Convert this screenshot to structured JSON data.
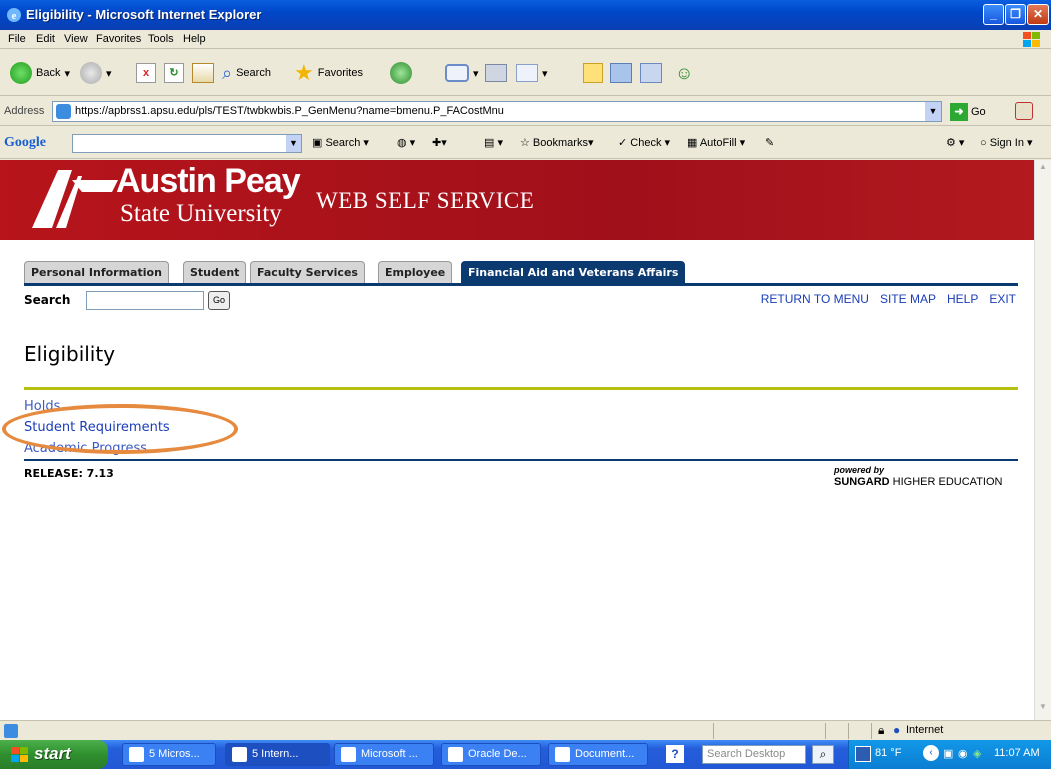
{
  "window": {
    "title": "Eligibility - Microsoft Internet Explorer"
  },
  "menu": [
    "File",
    "Edit",
    "View",
    "Favorites",
    "Tools",
    "Help"
  ],
  "toolbar": {
    "back": "Back",
    "search": "Search",
    "favorites": "Favorites"
  },
  "address": {
    "label": "Address",
    "url": "https://apbrss1.apsu.edu/pls/TEST/twbkwbis.P_GenMenu?name=bmenu.P_FACostMnu",
    "go": "Go"
  },
  "google": {
    "logo": "Google",
    "search": "Search",
    "bookmarks": "Bookmarks",
    "check": "Check",
    "autofill": "AutoFill",
    "signin": "Sign In"
  },
  "banner": {
    "uni_line1": "Austin Peay",
    "uni_line2": "State University",
    "title": "WEB SELF SERVICE"
  },
  "tabs": [
    {
      "label": "Personal Information",
      "active": false
    },
    {
      "label": "Student",
      "active": false
    },
    {
      "label": "Faculty Services",
      "active": false
    },
    {
      "label": "Employee",
      "active": false
    },
    {
      "label": "Financial Aid and Veterans Affairs",
      "active": true
    }
  ],
  "search": {
    "label": "Search",
    "go": "Go"
  },
  "toplinks": [
    "RETURN TO MENU",
    "SITE MAP",
    "HELP",
    "EXIT"
  ],
  "page": {
    "title": "Eligibility",
    "links": [
      "Holds",
      "Student Requirements",
      "Academic Progress"
    ],
    "release": "RELEASE: 7.13",
    "powered_by": "powered by",
    "sungard": "SUNGARD",
    "higher_ed": " HIGHER EDUCATION"
  },
  "statusbar": {
    "zone": "Internet"
  },
  "taskbar": {
    "start": "start",
    "items": [
      "5 Micros...",
      "5 Intern...",
      "Microsoft ...",
      "Oracle De...",
      "Document..."
    ],
    "search_placeholder": "Search Desktop",
    "temp": "81 °F",
    "time": "11:07 AM"
  },
  "colors": {
    "banner_red": "#b7141b",
    "nav_blue": "#0b3a70",
    "link_blue": "#1a3db8",
    "olive_rule": "#b6c00f",
    "highlight": "#e58a3e"
  }
}
